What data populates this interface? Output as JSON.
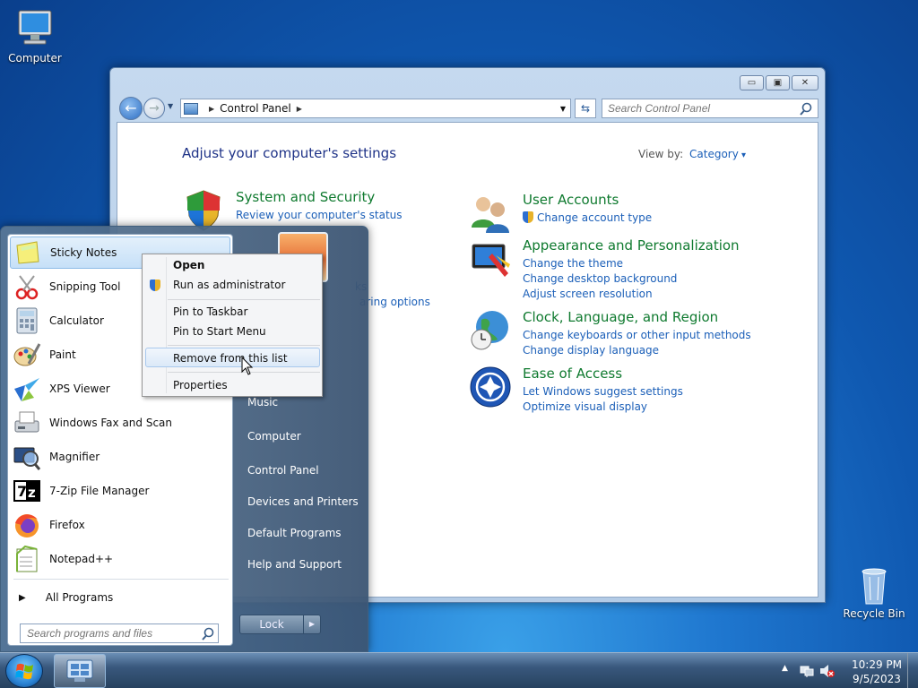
{
  "desktop": {
    "computer_label": "Computer",
    "recycle_label": "Recycle Bin"
  },
  "window": {
    "address": {
      "path": "Control Panel"
    },
    "search_placeholder": "Search Control Panel",
    "heading": "Adjust your computer's settings",
    "view_by_label": "View by:",
    "view_by_value": "Category",
    "categories": [
      {
        "title": "System and Security",
        "links": [
          "Review your computer's status"
        ]
      },
      {
        "title": "User Accounts",
        "links": [
          "Change account type"
        ]
      },
      {
        "title": "Appearance and Personalization",
        "links": [
          "Change the theme",
          "Change desktop background",
          "Adjust screen resolution"
        ]
      },
      {
        "title": "Clock, Language, and Region",
        "links": [
          "Change keyboards or other input methods",
          "Change display language"
        ]
      },
      {
        "title": "Ease of Access",
        "links": [
          "Let Windows suggest settings",
          "Optimize visual display"
        ]
      }
    ],
    "partial_texts": [
      "ks",
      "aring options"
    ]
  },
  "start_menu": {
    "programs": [
      {
        "label": "Sticky Notes",
        "icon": "sticky-notes-icon"
      },
      {
        "label": "Snipping Tool",
        "icon": "snipping-tool-icon"
      },
      {
        "label": "Calculator",
        "icon": "calculator-icon"
      },
      {
        "label": "Paint",
        "icon": "paint-icon"
      },
      {
        "label": "XPS Viewer",
        "icon": "xps-viewer-icon"
      },
      {
        "label": "Windows Fax and Scan",
        "icon": "fax-scan-icon"
      },
      {
        "label": "Magnifier",
        "icon": "magnifier-icon"
      },
      {
        "label": "7-Zip File Manager",
        "icon": "7zip-icon"
      },
      {
        "label": "Firefox",
        "icon": "firefox-icon"
      },
      {
        "label": "Notepad++",
        "icon": "notepad-plus-icon"
      }
    ],
    "all_programs": "All Programs",
    "search_placeholder": "Search programs and files",
    "right_items": [
      "Music",
      "Computer",
      "Control Panel",
      "Devices and Printers",
      "Default Programs",
      "Help and Support"
    ],
    "lock_label": "Lock"
  },
  "context_menu": {
    "items": [
      "Open",
      "Run as administrator",
      "Pin to Taskbar",
      "Pin to Start Menu",
      "Remove from this list",
      "Properties"
    ]
  },
  "taskbar": {
    "time": "10:29 PM",
    "date": "9/5/2023"
  }
}
